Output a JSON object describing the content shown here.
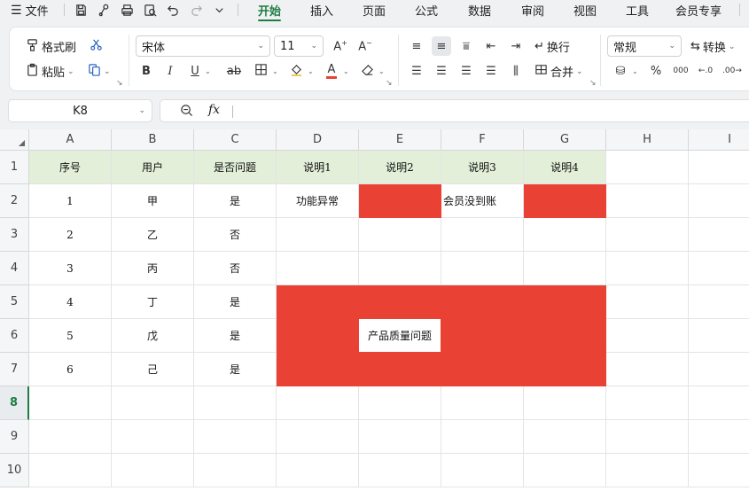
{
  "menu": {
    "file": "文件",
    "tabs": [
      "开始",
      "插入",
      "页面",
      "公式",
      "数据",
      "审阅",
      "视图",
      "工具",
      "会员专享"
    ]
  },
  "ribbon": {
    "format_painter": "格式刷",
    "paste": "粘贴",
    "font_name": "宋体",
    "font_size": "11",
    "wrap": "换行",
    "merge": "合并",
    "number_format": "常规",
    "convert": "转换"
  },
  "formula_bar": {
    "cell_ref": "K8",
    "fx": "fx",
    "value": ""
  },
  "columns": [
    "A",
    "B",
    "C",
    "D",
    "E",
    "F",
    "G",
    "H",
    "I"
  ],
  "rows": [
    "1",
    "2",
    "3",
    "4",
    "5",
    "6",
    "7",
    "8",
    "9",
    "10"
  ],
  "active_row": "8",
  "table": {
    "headers": [
      "序号",
      "用户",
      "是否问题",
      "说明1",
      "说明2",
      "说明3",
      "说明4"
    ],
    "data": [
      [
        "1",
        "甲",
        "是"
      ],
      [
        "2",
        "乙",
        "否"
      ],
      [
        "3",
        "丙",
        "否"
      ],
      [
        "4",
        "丁",
        "是"
      ],
      [
        "5",
        "戊",
        "是"
      ],
      [
        "6",
        "己",
        "是"
      ]
    ],
    "d2": "功能异常",
    "f2": "会员没到账",
    "merged_label": "产品质量问题"
  },
  "colors": {
    "accent": "#1e7d43",
    "header_fill": "#e3efd9",
    "red_fill": "#e94234"
  }
}
